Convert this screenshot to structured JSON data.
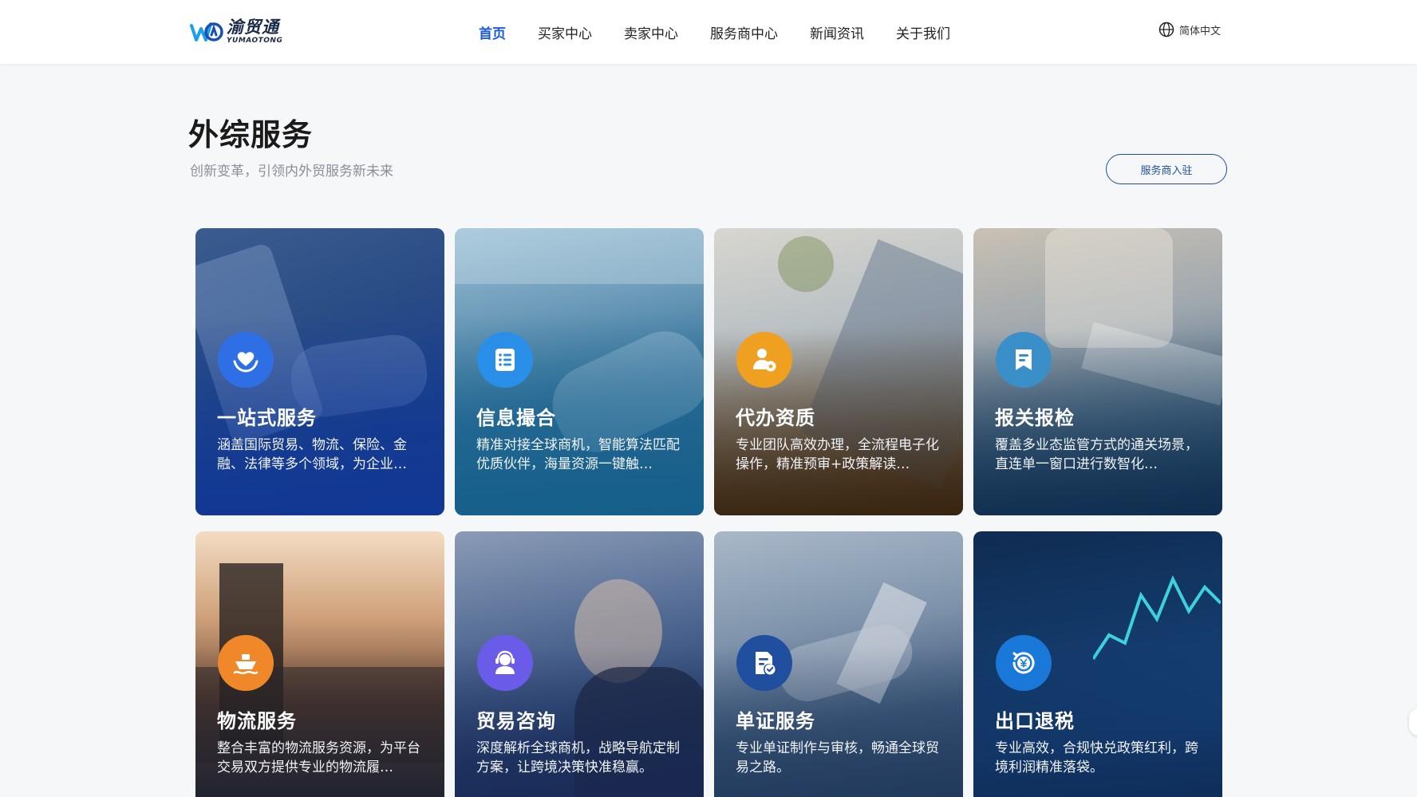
{
  "header": {
    "logo": {
      "cn": "渝贸通",
      "en": "YUMAOTONG"
    },
    "nav": [
      {
        "label": "首页",
        "active": true
      },
      {
        "label": "买家中心",
        "active": false
      },
      {
        "label": "卖家中心",
        "active": false
      },
      {
        "label": "服务商中心",
        "active": false
      },
      {
        "label": "新闻资讯",
        "active": false
      },
      {
        "label": "关于我们",
        "active": false
      }
    ],
    "language": {
      "icon": "globe-icon",
      "label": "简体中文"
    }
  },
  "page": {
    "title": "外综服务",
    "subtitle": "创新变革，引领内外贸服务新未来",
    "join_button": "服务商入驻"
  },
  "cards": [
    {
      "title": "一站式服务",
      "desc": "涵盖国际贸易、物流、保险、金融、法律等多个领域，为企业…",
      "icon": "heart-hand-icon",
      "icon_color": "#2f6fe6"
    },
    {
      "title": "信息撮合",
      "desc": "精准对接全球商机，智能算法匹配优质伙伴，海量资源一键触…",
      "icon": "list-document-icon",
      "icon_color": "#2a8fe8"
    },
    {
      "title": "代办资质",
      "desc": "专业团队高效办理，全流程电子化操作，精准预审+政策解读…",
      "icon": "agent-person-icon",
      "icon_color": "#f0a020"
    },
    {
      "title": "报关报检",
      "desc": "覆盖多业态监管方式的通关场景，直连单一窗口进行数智化…",
      "icon": "bookmark-icon",
      "icon_color": "#3a8fc8"
    },
    {
      "title": "物流服务",
      "desc": "整合丰富的物流服务资源，为平台交易双方提供专业的物流履…",
      "icon": "ship-icon",
      "icon_color": "#f0882a"
    },
    {
      "title": "贸易咨询",
      "desc": "深度解析全球商机，战略导航定制方案，让跨境决策快准稳赢。",
      "icon": "headset-person-icon",
      "icon_color": "#6a5ce8"
    },
    {
      "title": "单证服务",
      "desc": "专业单证制作与审核，畅通全球贸易之路。",
      "icon": "document-check-icon",
      "icon_color": "#1f4f9e"
    },
    {
      "title": "出口退税",
      "desc": "专业高效，合规快兑政策红利，跨境利润精准落袋。",
      "icon": "yen-refund-icon",
      "icon_color": "#1a78d8"
    }
  ]
}
